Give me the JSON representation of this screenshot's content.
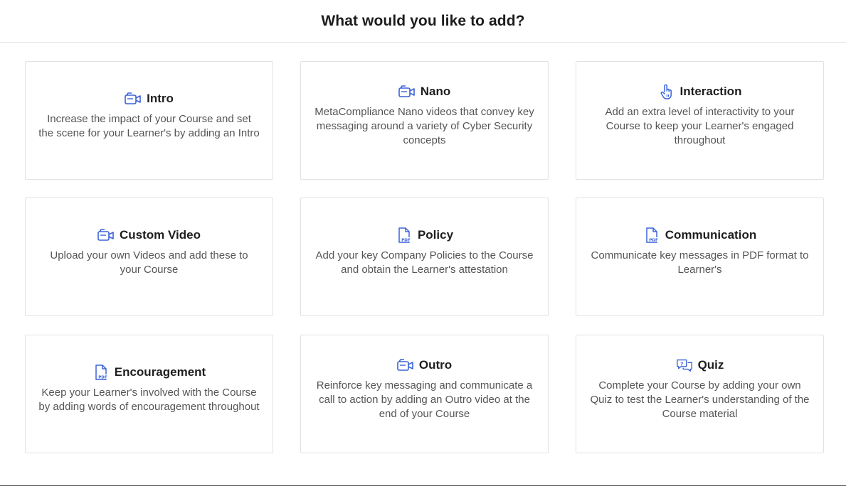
{
  "header": {
    "title": "What would you like to add?"
  },
  "colors": {
    "icon": "#3b63d8",
    "border": "#e2e2e2",
    "text": "#555555",
    "heading": "#1e1e1e"
  },
  "cards": [
    {
      "title": "Intro",
      "icon": "video-camera-icon",
      "description": "Increase the impact of your Course and set the scene for your Learner's by adding an Intro"
    },
    {
      "title": "Nano",
      "icon": "video-camera-icon",
      "description": "MetaCompliance Nano videos that convey key messaging around a variety of Cyber Security concepts"
    },
    {
      "title": "Interaction",
      "icon": "hand-pointer-icon",
      "description": "Add an extra level of interactivity to your Course to keep your Learner's engaged throughout"
    },
    {
      "title": "Custom Video",
      "icon": "video-camera-icon",
      "description": "Upload your own Videos and add these to your Course"
    },
    {
      "title": "Policy",
      "icon": "pdf-file-icon",
      "description": "Add your key Company Policies to the Course and obtain the Learner's attestation"
    },
    {
      "title": "Communication",
      "icon": "pdf-file-icon",
      "description": "Communicate key messages in PDF format to Learner's"
    },
    {
      "title": "Encouragement",
      "icon": "pdf-file-icon",
      "description": "Keep your Learner's involved with the Course by adding words of encouragement throughout"
    },
    {
      "title": "Outro",
      "icon": "video-camera-icon",
      "description": "Reinforce key messaging and communicate a call to action by adding an Outro video at the end of your Course"
    },
    {
      "title": "Quiz",
      "icon": "quiz-chat-icon",
      "description": "Complete your Course by adding your own Quiz to test the Learner's understanding of the Course material"
    }
  ]
}
